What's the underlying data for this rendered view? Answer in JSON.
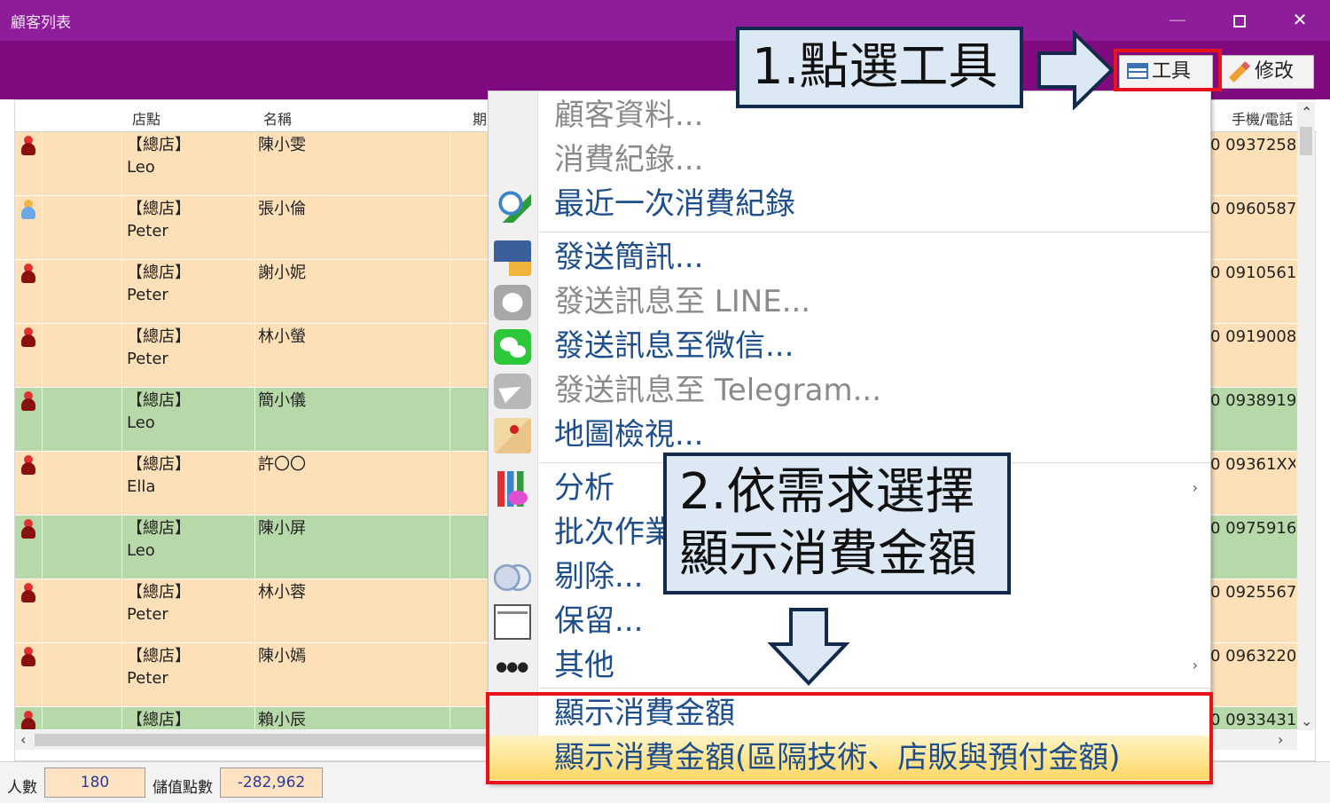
{
  "window": {
    "title": "顧客列表",
    "controls": {
      "minimize": "—",
      "close": "✕"
    }
  },
  "toolbar": {
    "tool_label": "工具",
    "edit_label": "修改"
  },
  "grid": {
    "headers": {
      "store": "店點",
      "name": "名稱",
      "period": "期",
      "phone": "手機/電話"
    },
    "rows": [
      {
        "store": "【總店】",
        "staff": "Leo",
        "name": "陳小雯",
        "phone": "0 0937258",
        "gender": "female",
        "color": "#fde0b8"
      },
      {
        "store": "【總店】",
        "staff": "Peter",
        "name": "張小倫",
        "phone": "0 0960587",
        "gender": "male",
        "color": "#fde0b8"
      },
      {
        "store": "【總店】",
        "staff": "Peter",
        "name": "謝小妮",
        "phone": "0 0910561",
        "gender": "female",
        "color": "#fde0b8"
      },
      {
        "store": "【總店】",
        "staff": "Peter",
        "name": "林小螢",
        "phone": "0 0919008",
        "gender": "female",
        "color": "#fde0b8"
      },
      {
        "store": "【總店】",
        "staff": "Leo",
        "name": "簡小儀",
        "phone": "0 0938919",
        "gender": "female",
        "color": "#b7d8a8"
      },
      {
        "store": "【總店】",
        "staff": "Ella",
        "name": "許〇〇",
        "phone": "0 09361XX",
        "gender": "female",
        "color": "#fde0b8"
      },
      {
        "store": "【總店】",
        "staff": "Leo",
        "name": "陳小屏",
        "phone": "0 0975916",
        "gender": "female",
        "color": "#b7d8a8"
      },
      {
        "store": "【總店】",
        "staff": "Peter",
        "name": "林小蓉",
        "phone": "0 0925567",
        "gender": "female",
        "color": "#fde0b8"
      },
      {
        "store": "【總店】",
        "staff": "Peter",
        "name": "陳小嫣",
        "phone": "0 0963220",
        "gender": "female",
        "color": "#fde0b8"
      },
      {
        "store": "【總店】",
        "staff": "",
        "name": "賴小辰",
        "phone": "0 0933431",
        "gender": "female",
        "color": "#b7d8a8"
      }
    ]
  },
  "status": {
    "count_label": "人數",
    "count_value": "180",
    "points_label": "儲值點數",
    "points_value": "-282,962"
  },
  "menu": {
    "items": [
      {
        "label": "顧客資料...",
        "enabled": false,
        "icon": "none"
      },
      {
        "label": "消費紀錄...",
        "enabled": false,
        "icon": "none"
      },
      {
        "label": "最近一次消費紀錄",
        "enabled": true,
        "icon": "search-person-icon"
      },
      {
        "label": "發送簡訊...",
        "enabled": true,
        "icon": "sms-icon"
      },
      {
        "label": "發送訊息至 LINE...",
        "enabled": false,
        "icon": "line-icon"
      },
      {
        "label": "發送訊息至微信...",
        "enabled": true,
        "icon": "wechat-icon"
      },
      {
        "label": "發送訊息至 Telegram...",
        "enabled": false,
        "icon": "telegram-icon"
      },
      {
        "label": "地圖檢視...",
        "enabled": true,
        "icon": "map-icon"
      },
      {
        "label": "分析",
        "enabled": true,
        "icon": "chart-icon",
        "submenu": true
      },
      {
        "label": "批次作業",
        "enabled": true,
        "icon": "none"
      },
      {
        "label": "剔除...",
        "enabled": true,
        "icon": "toggle-icon"
      },
      {
        "label": "保留...",
        "enabled": true,
        "icon": "keep-icon"
      },
      {
        "label": "其他",
        "enabled": true,
        "icon": "more-dots-icon",
        "submenu": true
      },
      {
        "label": "顯示消費金額",
        "enabled": true,
        "icon": "none"
      },
      {
        "label": "顯示消費金額(區隔技術、店販與預付金額)",
        "enabled": true,
        "icon": "none",
        "highlighted": true
      }
    ],
    "submenu_arrow": "›"
  },
  "annotations": {
    "step1": "1.點選工具",
    "step2_line1": "2.依需求選擇",
    "step2_line2": "顯示消費金額"
  },
  "colors": {
    "titlebar": "#8e1d9a",
    "toolbar": "#800a80",
    "row_orange": "#fde0b8",
    "row_green": "#b7d8a8",
    "menu_text": "#1e4e8c",
    "highlight": "#e8141c"
  }
}
